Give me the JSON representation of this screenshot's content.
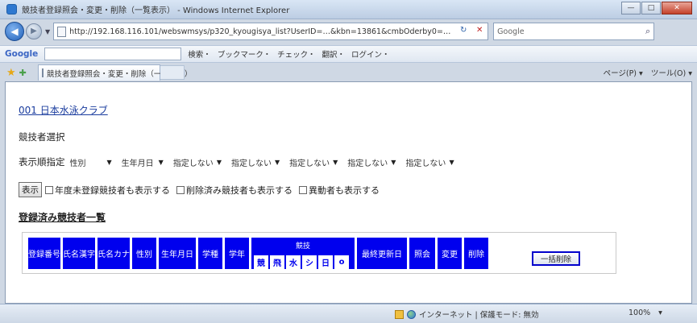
{
  "window": {
    "title": "競技者登録照会・変更・削除（一覧表示） - Windows Internet Explorer",
    "minimize": "—",
    "maximize": "□",
    "close": "✕"
  },
  "address": {
    "url": "http://192.168.116.101/webswmsys/p320_kyougisya_list?UserID=…&kbn=13861&cmbOderby0=…",
    "search_placeholder": "Google"
  },
  "google_toolbar": {
    "logo": "Google",
    "items": [
      "検索・",
      "ブックマーク・",
      "チェック・",
      "翻訳・",
      "ログイン・"
    ]
  },
  "favorites": {
    "tab_title": "競技者登録照会・変更・削除（一覧表示）",
    "commands": [
      "ページ(P) ▾",
      "ツール(O) ▾"
    ]
  },
  "page": {
    "club_link": "001 日本水泳クラブ",
    "section_label": "競技者選択",
    "sort_label": "表示順指定",
    "sort_selects": [
      "性別",
      "生年月日",
      "指定しない",
      "指定しない",
      "指定しない",
      "指定しない",
      "指定しない"
    ],
    "display_button": "表示",
    "options": [
      {
        "label": "年度未登録競技者も表示する",
        "checked": false
      },
      {
        "label": "削除済み競技者も表示する",
        "checked": false
      },
      {
        "label": "異動者も表示する",
        "checked": false
      }
    ],
    "list_title": "登録済み競技者一覧"
  },
  "table": {
    "headers": [
      "登録番号",
      "氏名漢字",
      "氏名カナ",
      "性別",
      "生年月日",
      "学種",
      "学年",
      "競技",
      "最終更新日",
      "照会",
      "変更",
      "削除"
    ],
    "sub_headers": [
      "競",
      "飛",
      "水",
      "シ",
      "日",
      "o"
    ],
    "bulk_delete_button": "一括削除"
  },
  "status": {
    "zone": "インターネット | 保護モード: 無効",
    "zoom": "100%",
    "zoom_arrow": "▾"
  }
}
